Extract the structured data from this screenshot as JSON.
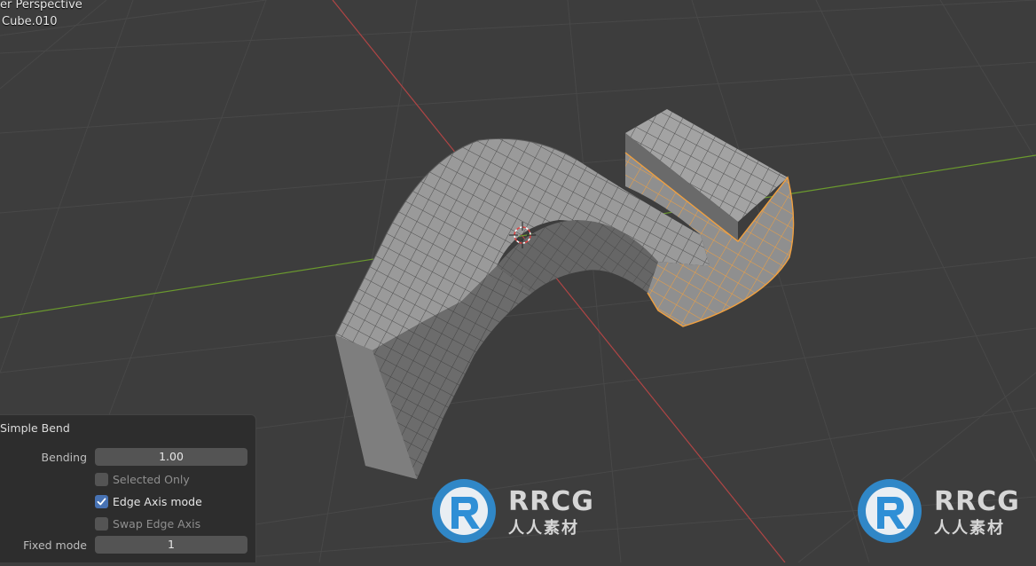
{
  "viewport": {
    "view_label": "er Perspective",
    "object_label": "Cube.010"
  },
  "operator_panel": {
    "title": "Simple Bend",
    "bending": {
      "label": "Bending",
      "value": "1.00"
    },
    "selected_only": {
      "label": "Selected Only",
      "checked": false
    },
    "edge_axis_mode": {
      "label": "Edge Axis mode",
      "checked": true
    },
    "swap_edge_axis": {
      "label": "Swap Edge Axis",
      "checked": false
    },
    "fixed_mode": {
      "label": "Fixed mode",
      "value": "1"
    }
  },
  "watermark": {
    "brand": "RRCG",
    "subtitle": "人人素材"
  },
  "colors": {
    "background": "#3d3d3d",
    "grid": "#4a4a4a",
    "axis_x": "#b84848",
    "axis_y": "#6b9a2e",
    "mesh_face": "#8a8a8a",
    "selection": "#f0a040",
    "panel": "#2d2d2d",
    "checkbox_on": "#4772b3",
    "watermark_blue": "#2f8fd6"
  }
}
